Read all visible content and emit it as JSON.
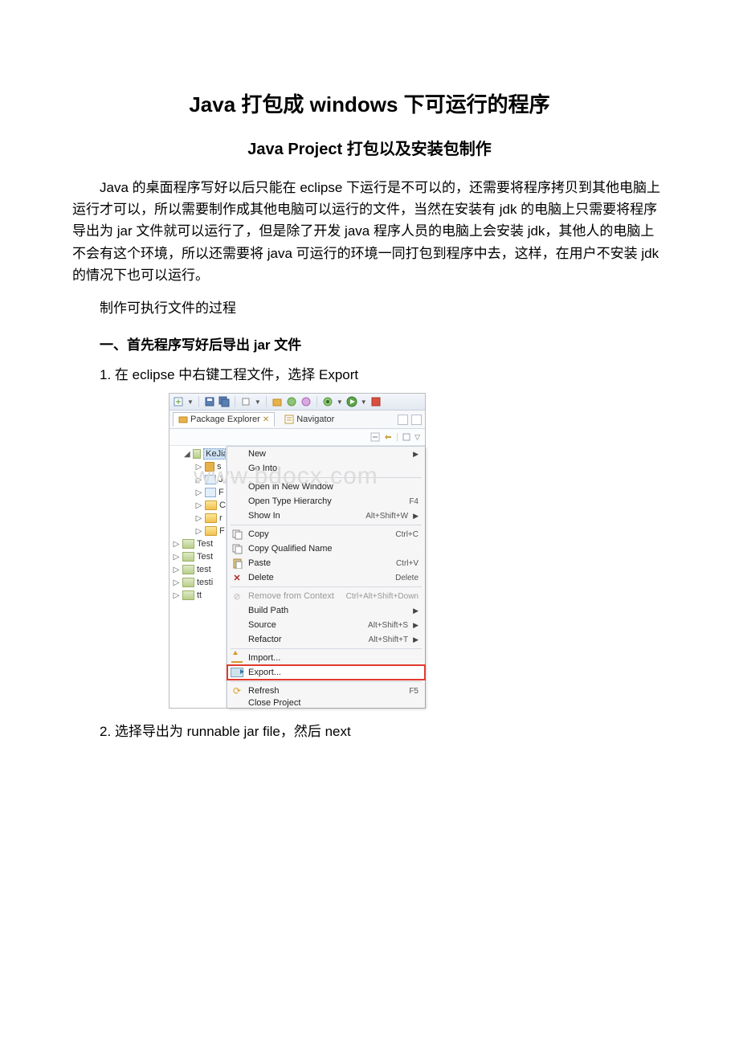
{
  "doc": {
    "title": "Java 打包成 windows 下可运行的程序",
    "subtitle": "Java Project 打包以及安装包制作",
    "para1": "Java 的桌面程序写好以后只能在 eclipse 下运行是不可以的，还需要将程序拷贝到其他电脑上运行才可以，所以需要制作成其他电脑可以运行的文件，当然在安装有 jdk 的电脑上只需要将程序导出为 jar 文件就可以运行了，但是除了开发 java 程序人员的电脑上会安装 jdk，其他人的电脑上不会有这个环境，所以还需要将 java 可运行的环境一同打包到程序中去，这样，在用户不安装 jdk 的情况下也可以运行。",
    "para2": "制作可执行文件的过程",
    "heading1": "一、首先程序写好后导出 jar 文件",
    "step1": "1. 在 eclipse 中右键工程文件，选择 Export",
    "step2": "2. 选择导出为 runnable jar file，然后 next"
  },
  "watermark": "www.bdocx.com",
  "tabs": {
    "package_explorer": "Package Explorer",
    "navigator": "Navigator"
  },
  "tree": {
    "root": "KeJian",
    "c1": "s",
    "c2": "J",
    "c3": "F",
    "c4": "C",
    "c5": "r",
    "c6": "F",
    "p1": "Test",
    "p2": "Test",
    "p3": "test",
    "p4": "testi",
    "p5": "tt"
  },
  "menu": {
    "new": "New",
    "go_into": "Go Into",
    "open_new_window": "Open in New Window",
    "open_type_hierarchy": "Open Type Hierarchy",
    "open_type_hierarchy_key": "F4",
    "show_in": "Show In",
    "show_in_key": "Alt+Shift+W",
    "copy": "Copy",
    "copy_key": "Ctrl+C",
    "copy_qualified": "Copy Qualified Name",
    "paste": "Paste",
    "paste_key": "Ctrl+V",
    "delete": "Delete",
    "delete_key": "Delete",
    "remove_context": "Remove from Context",
    "remove_context_key": "Ctrl+Alt+Shift+Down",
    "build_path": "Build Path",
    "source": "Source",
    "source_key": "Alt+Shift+S",
    "refactor": "Refactor",
    "refactor_key": "Alt+Shift+T",
    "import": "Import...",
    "export": "Export...",
    "refresh": "Refresh",
    "refresh_key": "F5",
    "close_project": "Close Project"
  }
}
